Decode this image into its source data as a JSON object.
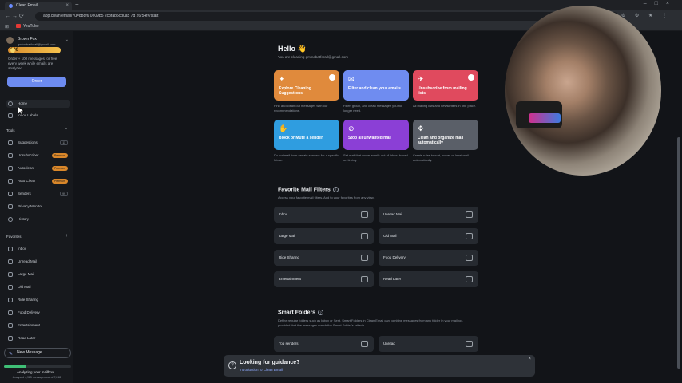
{
  "browser": {
    "tab_title": "Clean Email",
    "url": "app.clean.email/?u=8b8f6 0e09b5 2c3fab5cd0a5 7d 26f54f#/start",
    "bookmark": "YouTube",
    "nav_icons": "← → ⟳",
    "ext_icons": "⚙ ⚙ ★ ⋮"
  },
  "sidebar": {
    "profile": {
      "name": "Brown Fox",
      "email": "gmindbatforall@gmail.com"
    },
    "credits": "100",
    "order_text": "Order + 100 messages for free every week while emails are analyzed.",
    "order_button": "Order",
    "top_items": [
      {
        "label": "Home"
      },
      {
        "label": "Inbox Labels"
      }
    ],
    "tools_heading": "Tools",
    "tools": [
      {
        "label": "Suggestions",
        "count": "11"
      },
      {
        "label": "Unsubscriber",
        "badge": "Premium"
      },
      {
        "label": "Autoclean",
        "badge": "Premium"
      },
      {
        "label": "Auto Clean",
        "badge": "Premium"
      },
      {
        "label": "Senders",
        "count": "99"
      },
      {
        "label": "Privacy Monitor"
      },
      {
        "label": "History"
      }
    ],
    "favorites_heading": "Favorites",
    "favorites": [
      {
        "label": "Inbox"
      },
      {
        "label": "Unread Mail"
      },
      {
        "label": "Large Mail"
      },
      {
        "label": "Old Mail"
      },
      {
        "label": "Ride Sharing"
      },
      {
        "label": "Food Delivery"
      },
      {
        "label": "Entertainment"
      },
      {
        "label": "Read Later"
      }
    ],
    "new_message": "New Message",
    "progress": 0.33,
    "analyzing": "Analyzing your mailbox...",
    "analyzing_sub": "Analyzed 4,925 messages out of 7,818"
  },
  "main": {
    "hello": "Hello 👋",
    "hello_sub": "You are cleaning gmindbatforall@gmail.com",
    "cards": [
      {
        "title": "Explore Cleaning Suggestions",
        "desc": "Find and clean out messages with our recommendations.",
        "color": "#e08a3c",
        "icon": "✦"
      },
      {
        "title": "Filter and clean your emails",
        "desc": "Filter, group, and clean messages you no longer need.",
        "color": "#6f8cf0",
        "icon": "✉"
      },
      {
        "title": "Unsubscribe from mailing lists",
        "desc": "All mailing lists and newsletters in one place.",
        "color": "#e04a5e",
        "icon": "✈"
      },
      {
        "title": "Block or Mute a sender",
        "desc": "Do not mail from certain senders for a specific future.",
        "color": "#2f9de0",
        "icon": "✋"
      },
      {
        "title": "Stop all unwanted mail",
        "desc": "Set mail that move emails out of inbox, based on timing.",
        "color": "#8b3fd6",
        "icon": "⊘"
      },
      {
        "title": "Clean and organize mail automatically",
        "desc": "Create rules to sort, move, or label mail automatically.",
        "color": "#5a5f68",
        "icon": "✥"
      }
    ],
    "filters_title": "Favorite Mail Filters",
    "filters_sub": "Access your favorite mail filters. Add to your favorites from any view.",
    "filters": [
      {
        "label": "Inbox",
        "icon": "inbox-icon"
      },
      {
        "label": "Unread Mail",
        "icon": "unread-icon"
      },
      {
        "label": "Large Mail",
        "icon": "large-mail-icon"
      },
      {
        "label": "Old Mail",
        "icon": "old-mail-icon"
      },
      {
        "label": "Ride Sharing",
        "icon": "car-icon"
      },
      {
        "label": "Food Delivery",
        "icon": "truck-icon"
      },
      {
        "label": "Entertainment",
        "icon": "tag-icon"
      },
      {
        "label": "Read Later",
        "icon": "bookmark-icon"
      }
    ],
    "smart_title": "Smart Folders",
    "smart_sub": "Define regular folders such as Inbox or Sent, Smart Folders in Clean Email can combine messages from any folder in your mailbox, provided that the messages match the Smart Folder's criteria.",
    "smart_items": [
      {
        "label": "Top senders",
        "icon": "group-icon"
      },
      {
        "label": "Unread",
        "icon": "unread-icon"
      }
    ],
    "toast": {
      "title": "Looking for guidance?",
      "link": "Introduction to Clean Email",
      "close": "×"
    }
  }
}
